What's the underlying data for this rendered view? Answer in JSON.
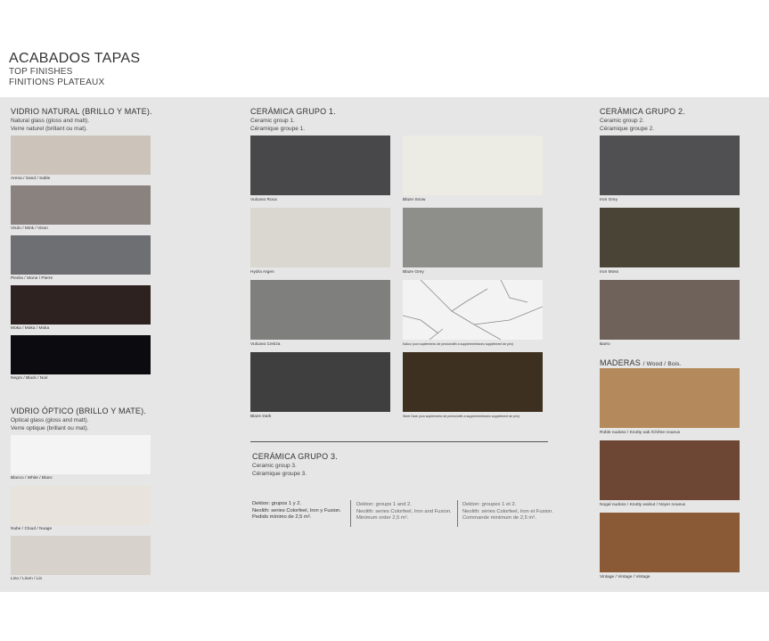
{
  "header": {
    "title": "ACABADOS TAPAS",
    "subtitle_en": "TOP FINISHES",
    "subtitle_fr": "FINITIONS PLATEAUX"
  },
  "vidrio_natural": {
    "title": "VIDRIO NATURAL (BRILLO Y MATE).",
    "sub1": "Natural glass (gloss and matt).",
    "sub2": "Verre naturel (brillant ou mat).",
    "swatches": [
      {
        "label": "Arena / Sand / Sable",
        "color": "#ccc4ba"
      },
      {
        "label": "Visón / Mink / Vison",
        "color": "#8a827e"
      },
      {
        "label": "Piedra / Stone / Pierre",
        "color": "#6e6f72"
      },
      {
        "label": "Moka / Moka / Moka",
        "color": "#2e2220"
      },
      {
        "label": "Negro / Black / Noir",
        "color": "#0c0c10"
      }
    ]
  },
  "vidrio_optico": {
    "title": "VIDRIO ÓPTICO (BRILLO Y MATE).",
    "sub1": "Optical glass (gloss and matt).",
    "sub2": "Verre optique (brillant ou mat).",
    "swatches": [
      {
        "label": "Blanco / White / Blanc",
        "color": "#f4f4f4"
      },
      {
        "label": "Nube / Cloud / Nuage",
        "color": "#e8e3dd"
      },
      {
        "label": "Lino / Linen / Lin",
        "color": "#d8d2cd"
      }
    ]
  },
  "ceramica_1": {
    "title": "CERÁMICA GRUPO 1.",
    "sub1": "Ceramic group 1.",
    "sub2": "Céramique groupe 1.",
    "swatches": [
      {
        "label": "Vulcano Roca",
        "color": "#48484a"
      },
      {
        "label": "Blaze Snow",
        "color": "#ecebe4"
      },
      {
        "label": "Hydra Argen",
        "color": "#d9d7cf"
      },
      {
        "label": "Blaze Grey",
        "color": "#8e8e8a"
      },
      {
        "label": "Vulcano Ceniza",
        "color": "#7f7f7d"
      },
      {
        "label": "Kalico (con suplemento de precio/with a supplement/avec supplément de prix)",
        "color": "#f3f3f3"
      },
      {
        "label": "Blaze Dark",
        "color": "#3f3f40"
      },
      {
        "label": "Steel Dark (con suplemento de precio/with a supplement/avec supplément de prix)",
        "color": "#3e3020"
      }
    ]
  },
  "ceramica_2": {
    "title": "CERÁMICA GRUPO 2.",
    "sub1": "Ceramic group 2.",
    "sub2": "Céramique groupe 2.",
    "swatches": [
      {
        "label": "Iron Grey",
        "color": "#505052"
      },
      {
        "label": "Iron Moss",
        "color": "#4a4436"
      },
      {
        "label": "Barro",
        "color": "#6e625a"
      }
    ]
  },
  "maderas": {
    "title": "MADERAS",
    "title_rest": "/ Wood / Bois.",
    "swatches": [
      {
        "label": "Roble nudoso / Knotty oak /Chêne noueux",
        "color": "#b48a5c"
      },
      {
        "label": "Nogal nudoso / Knotty walnut / Noyer noueux",
        "color": "#6e4634"
      },
      {
        "label": "Vintage / Vintage / Vintage",
        "color": "#8a5a36"
      }
    ]
  },
  "ceramica_3": {
    "title": "CERÁMICA GRUPO 3.",
    "sub1": "Ceramic group 3.",
    "sub2": "Céramique groupe 3."
  },
  "dekton": {
    "es": [
      "Dekton: grupos 1 y 2.",
      "Neolith: series Colorfeel, Iron y Fusion.",
      "Pedido mínimo de 2,5 m²."
    ],
    "en": [
      "Dekton: groups 1 and 2.",
      "Neolith: series Colorfeel, Iron and Fusion.",
      "Minimum order 2,5 m²."
    ],
    "fr": [
      "Dekton: groupes 1 et 2.",
      "Neolith: séries Colorfeel, Iron et Fusion.",
      "Commande minimum de 2,5 m²."
    ]
  }
}
